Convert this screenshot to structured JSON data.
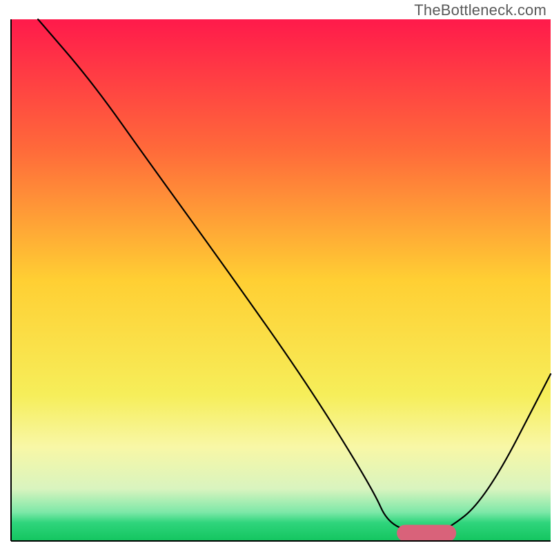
{
  "watermark": "TheBottleneck.com",
  "chart_data": {
    "type": "line",
    "title": "",
    "xlabel": "",
    "ylabel": "",
    "xlim": [
      0,
      100
    ],
    "ylim": [
      0,
      100
    ],
    "background_gradient": {
      "stops": [
        {
          "offset": 0.0,
          "color": "#ff1a4b"
        },
        {
          "offset": 0.25,
          "color": "#ff6a3a"
        },
        {
          "offset": 0.5,
          "color": "#ffcf33"
        },
        {
          "offset": 0.72,
          "color": "#f6ee5a"
        },
        {
          "offset": 0.82,
          "color": "#f8f7a6"
        },
        {
          "offset": 0.9,
          "color": "#d9f4bf"
        },
        {
          "offset": 0.945,
          "color": "#7de8a8"
        },
        {
          "offset": 0.965,
          "color": "#2fd57c"
        },
        {
          "offset": 1.0,
          "color": "#13c55f"
        }
      ]
    },
    "series": [
      {
        "name": "bottleneck-curve",
        "color": "#000000",
        "stroke_width": 2.2,
        "x": [
          5,
          15,
          26,
          40,
          55,
          67,
          70,
          76,
          80,
          88,
          100
        ],
        "y": [
          100,
          88,
          72,
          52,
          30,
          10,
          3,
          1.5,
          1.5,
          8,
          32
        ]
      }
    ],
    "marker": {
      "name": "optimal-marker",
      "color": "#d9627a",
      "x": 77,
      "y": 1.5,
      "rx": 5.5,
      "ry": 1.6
    },
    "axis": {
      "color": "#000000",
      "width": 2
    }
  }
}
